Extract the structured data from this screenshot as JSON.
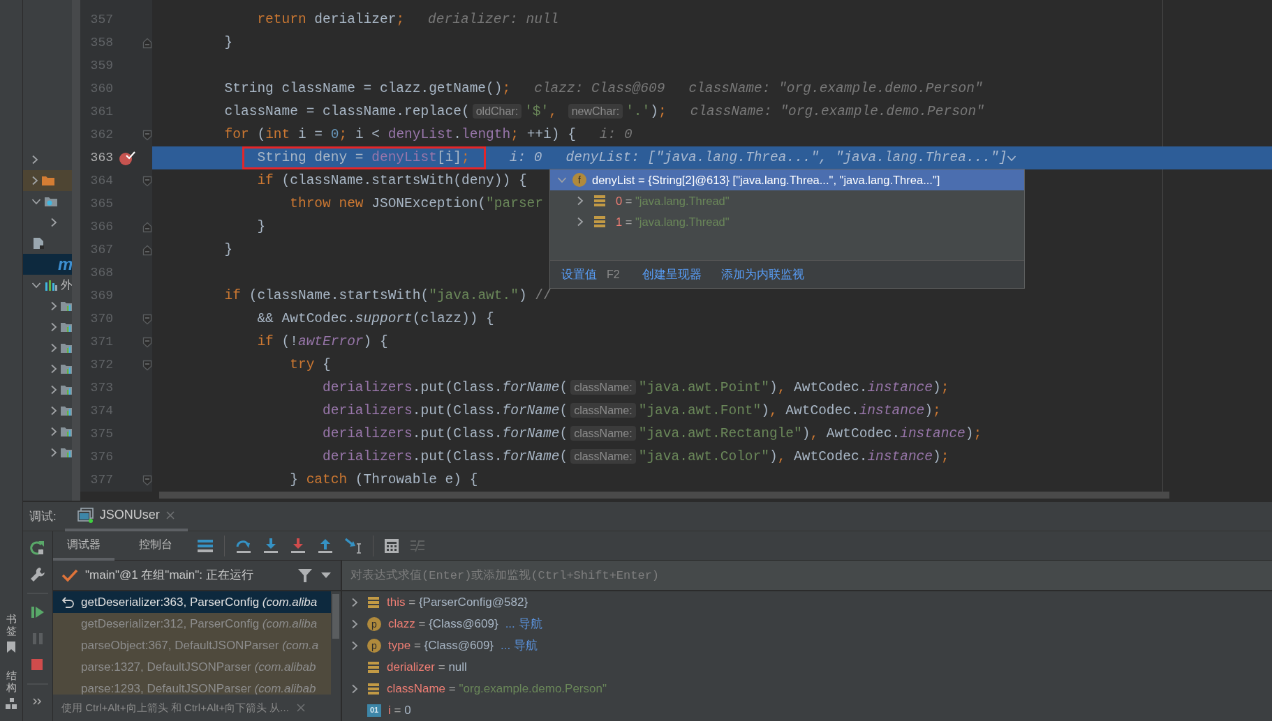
{
  "left_strip": [
    {
      "label": "书签"
    },
    {
      "label": "结构"
    }
  ],
  "project_tree": [
    {
      "expanded": false,
      "selected": false,
      "highlighted": false
    },
    {
      "kind": "source_folder",
      "expanded": false,
      "selected": false,
      "highlighted": true
    },
    {
      "kind": "package",
      "expanded": true,
      "selected": false,
      "highlighted": false,
      "children": [
        {
          "expanded": false,
          "selected": false,
          "highlighted": false
        }
      ]
    },
    {
      "kind": "file",
      "selected": false,
      "highlighted": false
    },
    {
      "label": "m",
      "selected": true,
      "highlighted": false
    },
    {
      "kind": "chart",
      "label": "外",
      "expanded": true,
      "selected": false,
      "highlighted": false,
      "children": [
        {
          "kind": "library",
          "expanded": false,
          "selected": false,
          "highlighted": false
        },
        {
          "kind": "library",
          "expanded": false,
          "selected": false,
          "highlighted": false
        },
        {
          "kind": "library",
          "expanded": false,
          "selected": false,
          "highlighted": false
        },
        {
          "kind": "library",
          "expanded": false,
          "selected": false,
          "highlighted": false
        },
        {
          "kind": "library",
          "expanded": false,
          "selected": false,
          "highlighted": false
        },
        {
          "kind": "library",
          "expanded": false,
          "selected": false,
          "highlighted": false
        },
        {
          "kind": "library",
          "expanded": false,
          "selected": false,
          "highlighted": false
        },
        {
          "kind": "library",
          "expanded": false,
          "selected": false,
          "highlighted": false
        }
      ]
    }
  ],
  "editor": {
    "lines": [
      {
        "number": "357",
        "kind": "plain",
        "breakpoint": false,
        "current": false,
        "tokens": [
          {
            "kind": "kw",
            "text": "            return "
          },
          {
            "kind": "plain",
            "text": "derializer"
          },
          {
            "kind": "kw",
            "text": ";"
          },
          {
            "kind": "hint",
            "text": "derializer: null"
          }
        ]
      },
      {
        "number": "358",
        "kind": "fold_end",
        "breakpoint": false,
        "current": false,
        "tokens": [
          {
            "kind": "plain",
            "text": "        }"
          }
        ]
      },
      {
        "number": "359",
        "kind": "plain",
        "breakpoint": false,
        "current": false
      },
      {
        "number": "360",
        "kind": "plain",
        "breakpoint": false,
        "current": false,
        "tokens": [
          {
            "kind": "plain",
            "text": "        String className = clazz.getName()"
          },
          {
            "kind": "kw",
            "text": ";"
          },
          {
            "kind": "hint",
            "text": "clazz: Class@609"
          },
          {
            "kind": "hint",
            "text": "className: \"org.example.demo.Person\""
          }
        ]
      },
      {
        "number": "361",
        "kind": "plain",
        "breakpoint": false,
        "current": false,
        "tokens": [
          {
            "kind": "plain",
            "text": "        className = className.replace("
          },
          {
            "kind": "inlay",
            "text": "oldChar:"
          },
          {
            "kind": "str",
            "text": "'$'"
          },
          {
            "kind": "kw",
            "text": ", "
          },
          {
            "kind": "inlay",
            "text": "newChar:"
          },
          {
            "kind": "str",
            "text": "'.'"
          },
          {
            "kind": "plain",
            "text": ")"
          },
          {
            "kind": "kw",
            "text": ";"
          },
          {
            "kind": "hint",
            "text": "className: \"org.example.demo.Person\""
          }
        ]
      },
      {
        "number": "362",
        "kind": "fold_start",
        "breakpoint": false,
        "current": false,
        "tokens": [
          {
            "kind": "kw",
            "text": "        for "
          },
          {
            "kind": "plain",
            "text": "("
          },
          {
            "kind": "kw",
            "text": "int "
          },
          {
            "kind": "plain",
            "text": "i = "
          },
          {
            "kind": "num",
            "text": "0"
          },
          {
            "kind": "kw",
            "text": "; "
          },
          {
            "kind": "plain",
            "text": "i < "
          },
          {
            "kind": "field",
            "text": "denyList"
          },
          {
            "kind": "plain",
            "text": "."
          },
          {
            "kind": "field",
            "text": "length"
          },
          {
            "kind": "kw",
            "text": "; "
          },
          {
            "kind": "plain",
            "text": "++i) {"
          },
          {
            "kind": "hint",
            "text": "i: 0"
          }
        ]
      },
      {
        "number": "363",
        "kind": "plain",
        "breakpoint": true,
        "current": true,
        "tokens": [
          {
            "kind": "plain",
            "text": "            String deny = ",
            "boxed": true
          },
          {
            "kind": "field",
            "text": "denyList",
            "boxed": true
          },
          {
            "kind": "plain",
            "text": "[i]",
            "boxed": true
          },
          {
            "kind": "kw",
            "text": ";",
            "boxed": true
          },
          {
            "kind": "hint",
            "text": "i: 0"
          },
          {
            "kind": "hint",
            "text": "denyList: [\"java.lang.Threa...\", \"java.lang.Threa...\"]",
            "expandable": true
          }
        ]
      },
      {
        "number": "364",
        "kind": "fold_start",
        "breakpoint": false,
        "current": false,
        "tokens": [
          {
            "kind": "kw",
            "text": "            if "
          },
          {
            "kind": "plain",
            "text": "(className.startsWith(deny)) {"
          }
        ]
      },
      {
        "number": "365",
        "kind": "plain",
        "breakpoint": false,
        "current": false,
        "tokens": [
          {
            "kind": "kw",
            "text": "                throw new "
          },
          {
            "kind": "plain",
            "text": "JSONException("
          },
          {
            "kind": "str",
            "text": "\"parser"
          }
        ]
      },
      {
        "number": "366",
        "kind": "fold_end",
        "breakpoint": false,
        "current": false,
        "tokens": [
          {
            "kind": "plain",
            "text": "            }"
          }
        ]
      },
      {
        "number": "367",
        "kind": "fold_end",
        "breakpoint": false,
        "current": false,
        "tokens": [
          {
            "kind": "plain",
            "text": "        }"
          }
        ]
      },
      {
        "number": "368",
        "kind": "plain",
        "breakpoint": false,
        "current": false
      },
      {
        "number": "369",
        "kind": "plain",
        "breakpoint": false,
        "current": false,
        "tokens": [
          {
            "kind": "kw",
            "text": "        if "
          },
          {
            "kind": "plain",
            "text": "(className.startsWith("
          },
          {
            "kind": "str",
            "text": "\"java.awt.\""
          },
          {
            "kind": "plain",
            "text": ") "
          },
          {
            "kind": "comment",
            "text": "//"
          }
        ]
      },
      {
        "number": "370",
        "kind": "fold_start",
        "breakpoint": false,
        "current": false,
        "tokens": [
          {
            "kind": "plain",
            "text": "            && AwtCodec."
          },
          {
            "kind": "smethod",
            "text": "support"
          },
          {
            "kind": "plain",
            "text": "(clazz)) {"
          }
        ]
      },
      {
        "number": "371",
        "kind": "fold_start",
        "breakpoint": false,
        "current": false,
        "tokens": [
          {
            "kind": "kw",
            "text": "            if "
          },
          {
            "kind": "plain",
            "text": "(!"
          },
          {
            "kind": "sfield",
            "text": "awtError"
          },
          {
            "kind": "plain",
            "text": ") {"
          }
        ]
      },
      {
        "number": "372",
        "kind": "fold_start",
        "breakpoint": false,
        "current": false,
        "tokens": [
          {
            "kind": "kw",
            "text": "                try "
          },
          {
            "kind": "plain",
            "text": "{"
          }
        ]
      },
      {
        "number": "373",
        "kind": "plain",
        "breakpoint": false,
        "current": false,
        "tokens": [
          {
            "kind": "field",
            "text": "                    derializers"
          },
          {
            "kind": "plain",
            "text": ".put(Class."
          },
          {
            "kind": "smethod",
            "text": "forName"
          },
          {
            "kind": "plain",
            "text": "("
          },
          {
            "kind": "inlay",
            "text": "className:"
          },
          {
            "kind": "str",
            "text": "\"java.awt.Point\""
          },
          {
            "kind": "plain",
            "text": ")"
          },
          {
            "kind": "kw",
            "text": ", "
          },
          {
            "kind": "plain",
            "text": "AwtCodec."
          },
          {
            "kind": "sfield",
            "text": "instance"
          },
          {
            "kind": "plain",
            "text": ")"
          },
          {
            "kind": "kw",
            "text": ";"
          }
        ]
      },
      {
        "number": "374",
        "kind": "plain",
        "breakpoint": false,
        "current": false,
        "tokens": [
          {
            "kind": "field",
            "text": "                    derializers"
          },
          {
            "kind": "plain",
            "text": ".put(Class."
          },
          {
            "kind": "smethod",
            "text": "forName"
          },
          {
            "kind": "plain",
            "text": "("
          },
          {
            "kind": "inlay",
            "text": "className:"
          },
          {
            "kind": "str",
            "text": "\"java.awt.Font\""
          },
          {
            "kind": "plain",
            "text": ")"
          },
          {
            "kind": "kw",
            "text": ", "
          },
          {
            "kind": "plain",
            "text": "AwtCodec."
          },
          {
            "kind": "sfield",
            "text": "instance"
          },
          {
            "kind": "plain",
            "text": ")"
          },
          {
            "kind": "kw",
            "text": ";"
          }
        ]
      },
      {
        "number": "375",
        "kind": "plain",
        "breakpoint": false,
        "current": false,
        "tokens": [
          {
            "kind": "field",
            "text": "                    derializers"
          },
          {
            "kind": "plain",
            "text": ".put(Class."
          },
          {
            "kind": "smethod",
            "text": "forName"
          },
          {
            "kind": "plain",
            "text": "("
          },
          {
            "kind": "inlay",
            "text": "className:"
          },
          {
            "kind": "str",
            "text": "\"java.awt.Rectangle\""
          },
          {
            "kind": "plain",
            "text": ")"
          },
          {
            "kind": "kw",
            "text": ", "
          },
          {
            "kind": "plain",
            "text": "AwtCodec."
          },
          {
            "kind": "sfield",
            "text": "instance"
          },
          {
            "kind": "plain",
            "text": ")"
          },
          {
            "kind": "kw",
            "text": ";"
          }
        ]
      },
      {
        "number": "376",
        "kind": "plain",
        "breakpoint": false,
        "current": false,
        "tokens": [
          {
            "kind": "field",
            "text": "                    derializers"
          },
          {
            "kind": "plain",
            "text": ".put(Class."
          },
          {
            "kind": "smethod",
            "text": "forName"
          },
          {
            "kind": "plain",
            "text": "("
          },
          {
            "kind": "inlay",
            "text": "className:"
          },
          {
            "kind": "str",
            "text": "\"java.awt.Color\""
          },
          {
            "kind": "plain",
            "text": ")"
          },
          {
            "kind": "kw",
            "text": ", "
          },
          {
            "kind": "plain",
            "text": "AwtCodec."
          },
          {
            "kind": "sfield",
            "text": "instance"
          },
          {
            "kind": "plain",
            "text": ")"
          },
          {
            "kind": "kw",
            "text": ";"
          }
        ]
      },
      {
        "number": "377",
        "kind": "fold_start",
        "breakpoint": false,
        "current": false,
        "tokens": [
          {
            "kind": "plain",
            "text": "                } "
          },
          {
            "kind": "kw",
            "text": "catch "
          },
          {
            "kind": "plain",
            "text": "(Throwable e) {"
          }
        ]
      }
    ]
  },
  "value_popup": {
    "header": {
      "expanded": true,
      "badge": "f",
      "text": "denyList = {String[2]@613} [\"java.lang.Threa...\", \"java.lang.Threa...\"]"
    },
    "children": [
      {
        "expanded": false,
        "name": "0",
        "equals": "=",
        "value": "\"java.lang.Thread\""
      },
      {
        "expanded": false,
        "name": "1",
        "equals": "=",
        "value": "\"java.lang.Thread\""
      }
    ],
    "actions": [
      {
        "label": "设置值",
        "shortcut": "F2"
      },
      {
        "label": "创建呈现器"
      },
      {
        "label": "添加为内联监视"
      }
    ]
  },
  "debug": {
    "label": "调试:",
    "session_tab": {
      "title": "JSONUser",
      "selected": true
    },
    "view_tabs": [
      {
        "label": "调试器",
        "selected": true
      },
      {
        "label": "控制台",
        "selected": false
      }
    ],
    "thread": "\"main\"@1 在组\"main\": 正在运行",
    "frames": [
      {
        "text": "getDeserializer:363, ParserConfig *(com.aliba*",
        "selected": true
      },
      {
        "text": "getDeserializer:312, ParserConfig *(com.aliba*",
        "selected": false
      },
      {
        "text": "parseObject:367, DefaultJSONParser *(com.a*",
        "selected": false
      },
      {
        "text": "parse:1327, DefaultJSONParser *(com.alibab*",
        "selected": false
      },
      {
        "text": "parse:1293, DefaultJSONParser *(com.alibab*",
        "selected": false
      }
    ],
    "frames_hint": "使用 Ctrl+Alt+向上箭头 和 Ctrl+Alt+向下箭头 从...",
    "evaluate": {
      "placeholder": "对表达式求值(Enter)或添加监视(Ctrl+Shift+Enter)"
    },
    "variables": [
      {
        "expandable": true,
        "expanded": false,
        "kind": "field",
        "name": "this",
        "equals": "=",
        "value": "{ParserConfig@582}",
        "string": false
      },
      {
        "expandable": true,
        "expanded": false,
        "kind": "badge",
        "badge": "p",
        "name": "clazz",
        "equals": "=",
        "value": "{Class@609}",
        "string": false,
        "link": "... 导航"
      },
      {
        "expandable": true,
        "expanded": false,
        "kind": "badge",
        "badge": "p",
        "name": "type",
        "equals": "=",
        "value": "{Class@609}",
        "string": false,
        "link": "... 导航"
      },
      {
        "expandable": false,
        "kind": "field",
        "name": "derializer",
        "equals": "=",
        "value": "null",
        "string": false
      },
      {
        "expandable": true,
        "expanded": false,
        "kind": "field",
        "name": "className",
        "equals": "=",
        "value": "\"org.example.demo.Person\"",
        "string": true
      },
      {
        "expandable": false,
        "kind": "primitive",
        "badge": "01",
        "name": "i",
        "equals": "=",
        "value": "0",
        "string": false
      }
    ]
  }
}
